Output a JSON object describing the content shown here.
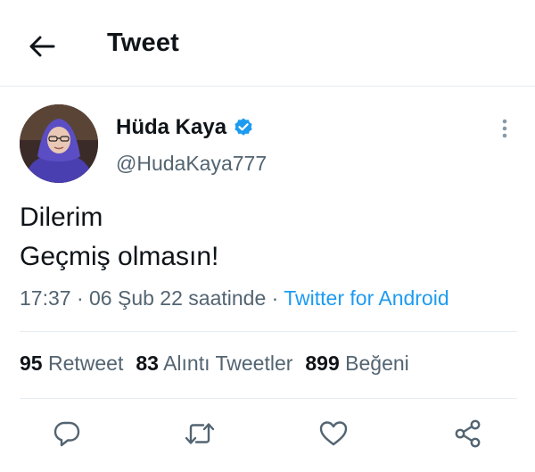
{
  "header": {
    "title": "Tweet"
  },
  "tweet": {
    "author_name": "Hüda Kaya",
    "author_handle": "@HudaKaya777",
    "text_lines": [
      "Dilerim",
      "Geçmiş olmasın!"
    ],
    "time": "17:37",
    "date": "06 Şub 22 saatinde",
    "source": "Twitter for Android"
  },
  "stats": {
    "retweets": {
      "count": "95",
      "label": "Retweet"
    },
    "quotes": {
      "count": "83",
      "label": "Alıntı Tweetler"
    },
    "likes": {
      "count": "899",
      "label": "Beğeni"
    }
  },
  "colors": {
    "accent": "#1d9bf0",
    "text": "#0f1419",
    "muted": "#536471",
    "divider": "#e6ecf0"
  },
  "icons": {
    "back": "arrow-left-icon",
    "verified": "verified-badge-icon",
    "more": "more-vertical-icon",
    "reply": "reply-icon",
    "retweet": "retweet-icon",
    "like": "heart-icon",
    "share": "share-icon"
  }
}
